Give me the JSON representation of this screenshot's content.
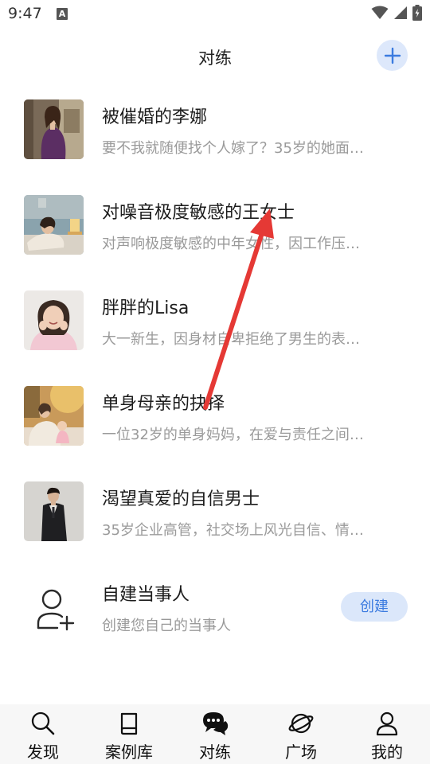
{
  "status_bar": {
    "time": "9:47",
    "notification_glyph": "A"
  },
  "header": {
    "title": "对练",
    "add_icon": "plus-icon"
  },
  "roles": [
    {
      "name": "被催婚的李娜",
      "desc": "要不我就随便找个人嫁了？35岁的她面…"
    },
    {
      "name": "对噪音极度敏感的王女士",
      "desc": "对声响极度敏感的中年女性，因工作压…"
    },
    {
      "name": "胖胖的Lisa",
      "desc": "大一新生，因身材自卑拒绝了男生的表…"
    },
    {
      "name": "单身母亲的抉择",
      "desc": "一位32岁的单身妈妈，在爱与责任之间…"
    },
    {
      "name": "渴望真爱的自信男士",
      "desc": "35岁企业高管，社交场上风光自信、情…"
    }
  ],
  "custom_role": {
    "name": "自建当事人",
    "desc": "创建您自己的当事人",
    "button": "创建"
  },
  "tabs": [
    {
      "label": "发现",
      "icon": "search-icon"
    },
    {
      "label": "案例库",
      "icon": "book-icon"
    },
    {
      "label": "对练",
      "icon": "chat-bubbles-icon",
      "active": true
    },
    {
      "label": "广场",
      "icon": "planet-icon"
    },
    {
      "label": "我的",
      "icon": "person-icon"
    }
  ],
  "colors": {
    "accent": "#3b7be0",
    "accent_light": "#dbe7fa",
    "annotation_arrow": "#e53935"
  }
}
